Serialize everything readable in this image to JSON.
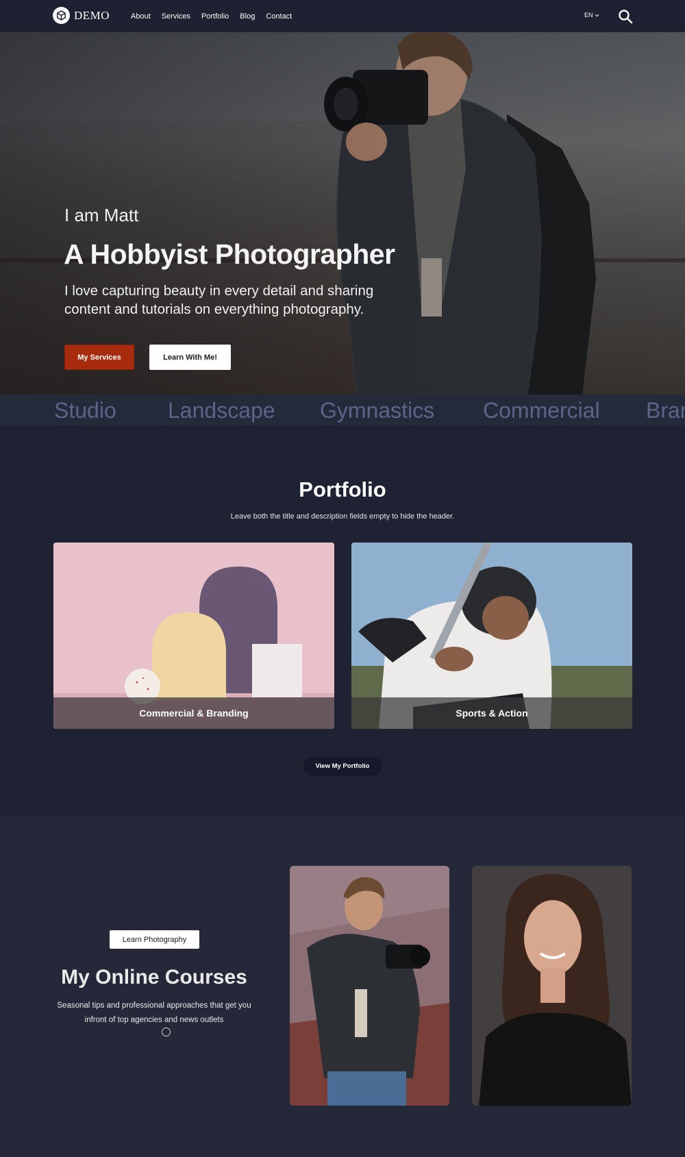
{
  "header": {
    "logo_text": "DEMO",
    "nav": [
      "About",
      "Services",
      "Portfolio",
      "Blog",
      "Contact"
    ],
    "language": "EN"
  },
  "hero": {
    "intro": "I am Matt",
    "title": "A Hobbyist Photographer",
    "description": "I love capturing beauty in every detail and sharing content and tutorials on everything photography.",
    "primary_button": "My Services",
    "secondary_button": "Learn With Me!"
  },
  "marquee": [
    "Studio",
    "Landscape",
    "Gymnastics",
    "Commercial",
    "Bran"
  ],
  "portfolio": {
    "title": "Portfolio",
    "subtitle": "Leave both the title and description fields empty to hide the header.",
    "cards": [
      {
        "caption": "Commercial & Branding"
      },
      {
        "caption": "Sports & Action"
      }
    ],
    "button": "View My Portfolio"
  },
  "courses": {
    "badge": "Learn Photography",
    "title": "My Online Courses",
    "description": "Seasonal tips and professional approaches that get you infront of top agencies and news outlets"
  },
  "colors": {
    "background": "#1f2232",
    "accent": "#a82b0e",
    "marquee_text": "#5a6588"
  }
}
